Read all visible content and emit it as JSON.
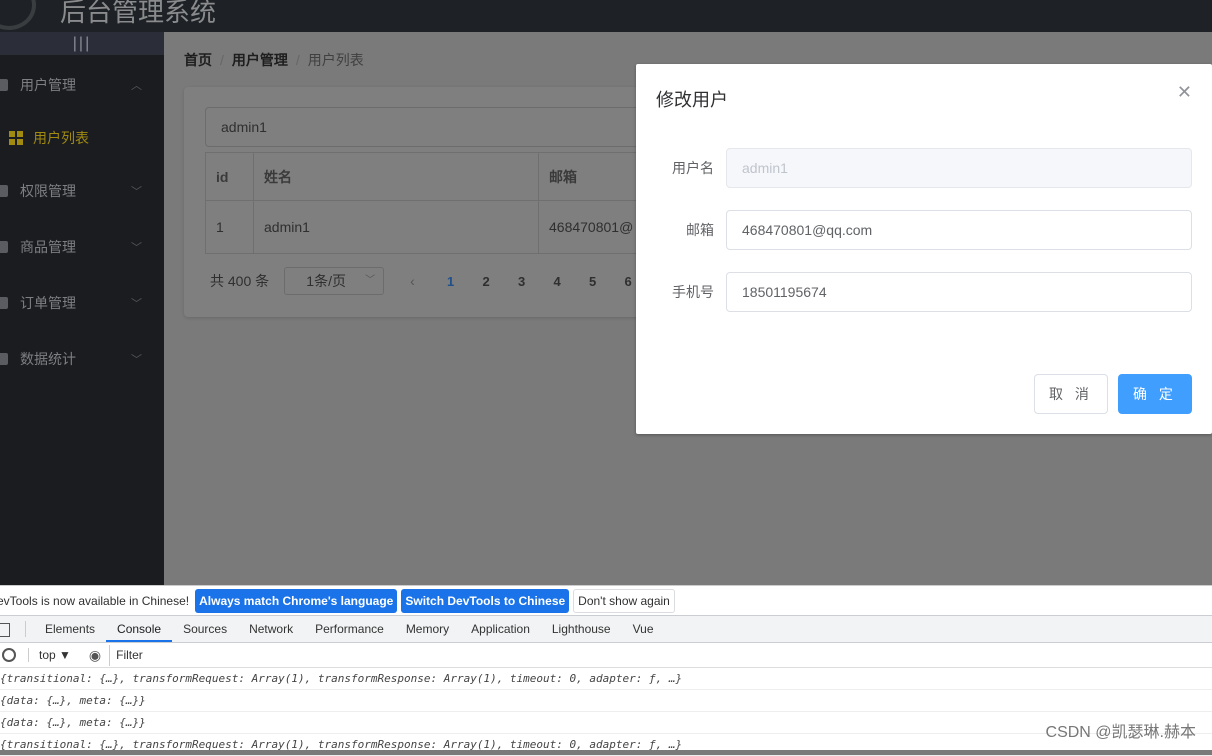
{
  "app": {
    "title": "后台管理系统",
    "toggle": "|||"
  },
  "sidebar": {
    "items": [
      {
        "label": "用户管理",
        "icon": "user-icon",
        "expanded": true
      },
      {
        "label": "用户列表",
        "icon": "grid-icon",
        "active": true
      },
      {
        "label": "权限管理",
        "icon": "lock-icon"
      },
      {
        "label": "商品管理",
        "icon": "bag-icon"
      },
      {
        "label": "订单管理",
        "icon": "document-icon"
      },
      {
        "label": "数据统计",
        "icon": "chart-icon"
      }
    ]
  },
  "breadcrumb": [
    "首页",
    "用户管理",
    "用户列表"
  ],
  "search": {
    "value": "admin1"
  },
  "table": {
    "headers": [
      "id",
      "姓名",
      "邮箱"
    ],
    "rows": [
      [
        "1",
        "admin1",
        "468470801@"
      ]
    ]
  },
  "pager": {
    "total": "共 400 条",
    "size": "1条/页",
    "pages": [
      "1",
      "2",
      "3",
      "4",
      "5",
      "6"
    ],
    "current": "1"
  },
  "dialog": {
    "title": "修改用户",
    "fields": [
      {
        "label": "用户名",
        "value": "admin1",
        "disabled": true
      },
      {
        "label": "邮箱",
        "value": "468470801@qq.com"
      },
      {
        "label": "手机号",
        "value": "18501195674"
      }
    ],
    "cancel": "取 消",
    "ok": "确 定",
    "accent": "#409eff"
  },
  "devtools": {
    "infobar": {
      "text": "evTools is now available in Chinese!",
      "btn1": "Always match Chrome's language",
      "btn2": "Switch DevTools to Chinese",
      "btn3": "Don't show again"
    },
    "tabs": [
      "Elements",
      "Console",
      "Sources",
      "Network",
      "Performance",
      "Memory",
      "Application",
      "Lighthouse",
      "Vue"
    ],
    "active_tab": "Console",
    "context": "top ▼",
    "filter_placeholder": "Filter",
    "logs": [
      "{transitional: {…}, transformRequest: Array(1), transformResponse: Array(1), timeout: 0, adapter: ƒ, …}",
      "{data: {…}, meta: {…}}",
      "{data: {…}, meta: {…}}",
      "{transitional: {…}, transformRequest: Array(1), transformResponse: Array(1), timeout: 0, adapter: ƒ, …}"
    ]
  },
  "watermark": "CSDN @凯瑟琳.赫本"
}
